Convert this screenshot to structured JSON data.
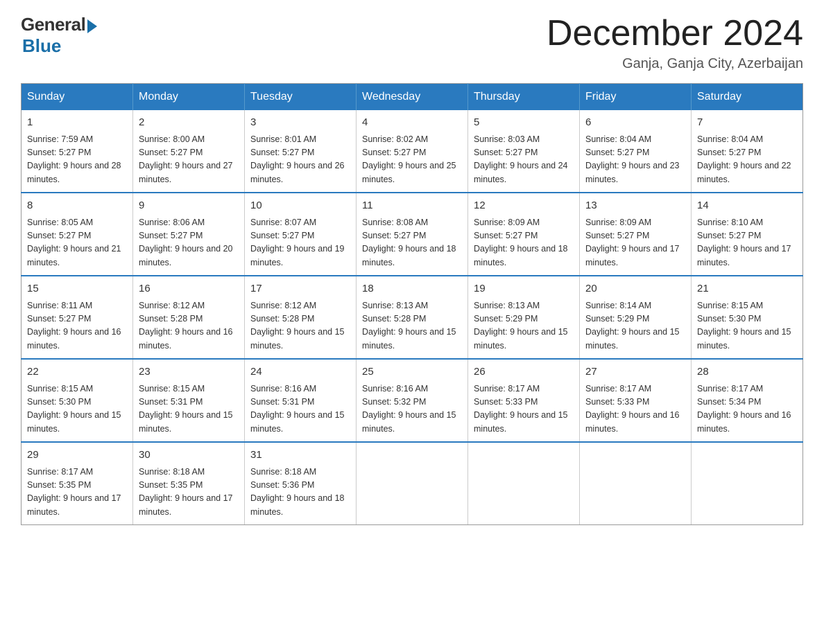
{
  "header": {
    "logo_general": "General",
    "logo_blue": "Blue",
    "title": "December 2024",
    "location": "Ganja, Ganja City, Azerbaijan"
  },
  "weekdays": [
    "Sunday",
    "Monday",
    "Tuesday",
    "Wednesday",
    "Thursday",
    "Friday",
    "Saturday"
  ],
  "weeks": [
    [
      {
        "day": "1",
        "sunrise": "Sunrise: 7:59 AM",
        "sunset": "Sunset: 5:27 PM",
        "daylight": "Daylight: 9 hours and 28 minutes."
      },
      {
        "day": "2",
        "sunrise": "Sunrise: 8:00 AM",
        "sunset": "Sunset: 5:27 PM",
        "daylight": "Daylight: 9 hours and 27 minutes."
      },
      {
        "day": "3",
        "sunrise": "Sunrise: 8:01 AM",
        "sunset": "Sunset: 5:27 PM",
        "daylight": "Daylight: 9 hours and 26 minutes."
      },
      {
        "day": "4",
        "sunrise": "Sunrise: 8:02 AM",
        "sunset": "Sunset: 5:27 PM",
        "daylight": "Daylight: 9 hours and 25 minutes."
      },
      {
        "day": "5",
        "sunrise": "Sunrise: 8:03 AM",
        "sunset": "Sunset: 5:27 PM",
        "daylight": "Daylight: 9 hours and 24 minutes."
      },
      {
        "day": "6",
        "sunrise": "Sunrise: 8:04 AM",
        "sunset": "Sunset: 5:27 PM",
        "daylight": "Daylight: 9 hours and 23 minutes."
      },
      {
        "day": "7",
        "sunrise": "Sunrise: 8:04 AM",
        "sunset": "Sunset: 5:27 PM",
        "daylight": "Daylight: 9 hours and 22 minutes."
      }
    ],
    [
      {
        "day": "8",
        "sunrise": "Sunrise: 8:05 AM",
        "sunset": "Sunset: 5:27 PM",
        "daylight": "Daylight: 9 hours and 21 minutes."
      },
      {
        "day": "9",
        "sunrise": "Sunrise: 8:06 AM",
        "sunset": "Sunset: 5:27 PM",
        "daylight": "Daylight: 9 hours and 20 minutes."
      },
      {
        "day": "10",
        "sunrise": "Sunrise: 8:07 AM",
        "sunset": "Sunset: 5:27 PM",
        "daylight": "Daylight: 9 hours and 19 minutes."
      },
      {
        "day": "11",
        "sunrise": "Sunrise: 8:08 AM",
        "sunset": "Sunset: 5:27 PM",
        "daylight": "Daylight: 9 hours and 18 minutes."
      },
      {
        "day": "12",
        "sunrise": "Sunrise: 8:09 AM",
        "sunset": "Sunset: 5:27 PM",
        "daylight": "Daylight: 9 hours and 18 minutes."
      },
      {
        "day": "13",
        "sunrise": "Sunrise: 8:09 AM",
        "sunset": "Sunset: 5:27 PM",
        "daylight": "Daylight: 9 hours and 17 minutes."
      },
      {
        "day": "14",
        "sunrise": "Sunrise: 8:10 AM",
        "sunset": "Sunset: 5:27 PM",
        "daylight": "Daylight: 9 hours and 17 minutes."
      }
    ],
    [
      {
        "day": "15",
        "sunrise": "Sunrise: 8:11 AM",
        "sunset": "Sunset: 5:27 PM",
        "daylight": "Daylight: 9 hours and 16 minutes."
      },
      {
        "day": "16",
        "sunrise": "Sunrise: 8:12 AM",
        "sunset": "Sunset: 5:28 PM",
        "daylight": "Daylight: 9 hours and 16 minutes."
      },
      {
        "day": "17",
        "sunrise": "Sunrise: 8:12 AM",
        "sunset": "Sunset: 5:28 PM",
        "daylight": "Daylight: 9 hours and 15 minutes."
      },
      {
        "day": "18",
        "sunrise": "Sunrise: 8:13 AM",
        "sunset": "Sunset: 5:28 PM",
        "daylight": "Daylight: 9 hours and 15 minutes."
      },
      {
        "day": "19",
        "sunrise": "Sunrise: 8:13 AM",
        "sunset": "Sunset: 5:29 PM",
        "daylight": "Daylight: 9 hours and 15 minutes."
      },
      {
        "day": "20",
        "sunrise": "Sunrise: 8:14 AM",
        "sunset": "Sunset: 5:29 PM",
        "daylight": "Daylight: 9 hours and 15 minutes."
      },
      {
        "day": "21",
        "sunrise": "Sunrise: 8:15 AM",
        "sunset": "Sunset: 5:30 PM",
        "daylight": "Daylight: 9 hours and 15 minutes."
      }
    ],
    [
      {
        "day": "22",
        "sunrise": "Sunrise: 8:15 AM",
        "sunset": "Sunset: 5:30 PM",
        "daylight": "Daylight: 9 hours and 15 minutes."
      },
      {
        "day": "23",
        "sunrise": "Sunrise: 8:15 AM",
        "sunset": "Sunset: 5:31 PM",
        "daylight": "Daylight: 9 hours and 15 minutes."
      },
      {
        "day": "24",
        "sunrise": "Sunrise: 8:16 AM",
        "sunset": "Sunset: 5:31 PM",
        "daylight": "Daylight: 9 hours and 15 minutes."
      },
      {
        "day": "25",
        "sunrise": "Sunrise: 8:16 AM",
        "sunset": "Sunset: 5:32 PM",
        "daylight": "Daylight: 9 hours and 15 minutes."
      },
      {
        "day": "26",
        "sunrise": "Sunrise: 8:17 AM",
        "sunset": "Sunset: 5:33 PM",
        "daylight": "Daylight: 9 hours and 15 minutes."
      },
      {
        "day": "27",
        "sunrise": "Sunrise: 8:17 AM",
        "sunset": "Sunset: 5:33 PM",
        "daylight": "Daylight: 9 hours and 16 minutes."
      },
      {
        "day": "28",
        "sunrise": "Sunrise: 8:17 AM",
        "sunset": "Sunset: 5:34 PM",
        "daylight": "Daylight: 9 hours and 16 minutes."
      }
    ],
    [
      {
        "day": "29",
        "sunrise": "Sunrise: 8:17 AM",
        "sunset": "Sunset: 5:35 PM",
        "daylight": "Daylight: 9 hours and 17 minutes."
      },
      {
        "day": "30",
        "sunrise": "Sunrise: 8:18 AM",
        "sunset": "Sunset: 5:35 PM",
        "daylight": "Daylight: 9 hours and 17 minutes."
      },
      {
        "day": "31",
        "sunrise": "Sunrise: 8:18 AM",
        "sunset": "Sunset: 5:36 PM",
        "daylight": "Daylight: 9 hours and 18 minutes."
      },
      null,
      null,
      null,
      null
    ]
  ]
}
